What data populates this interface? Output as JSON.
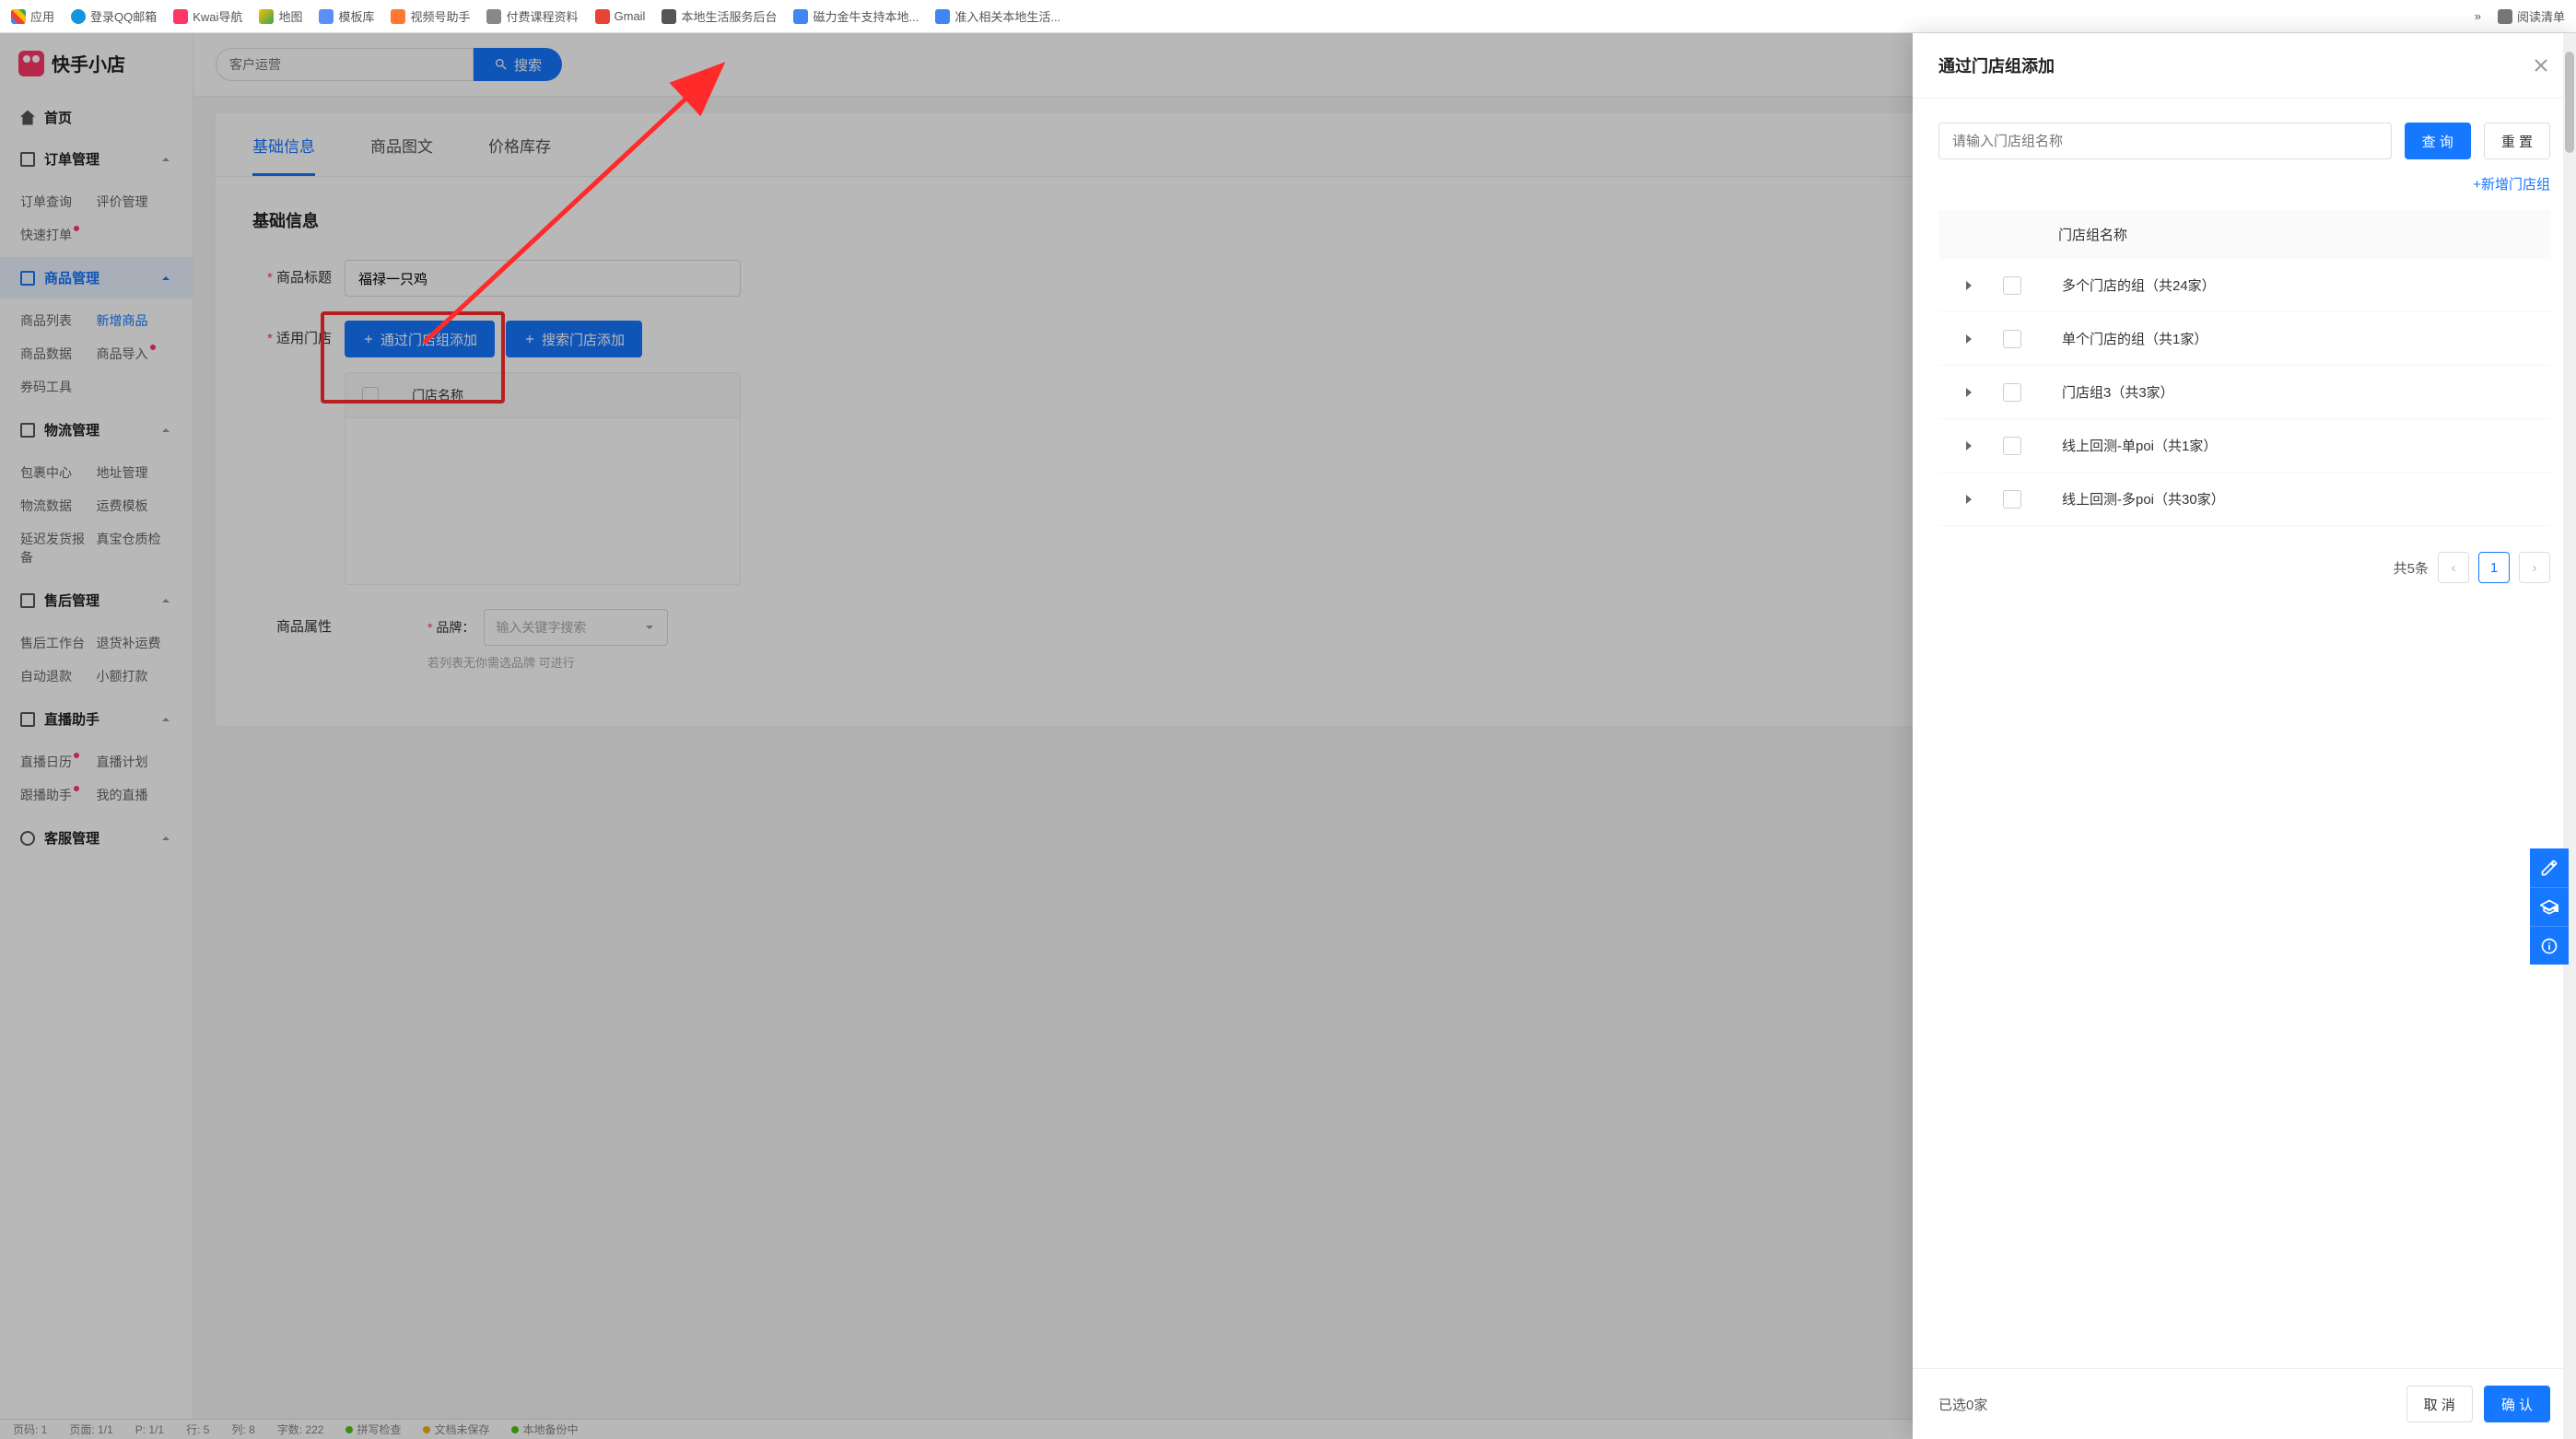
{
  "bookmarks": {
    "apps": "应用",
    "qq": "登录QQ邮箱",
    "kwai": "Kwai导航",
    "map": "地图",
    "template": "模板库",
    "video": "视频号助手",
    "paid": "付费课程资料",
    "gmail": "Gmail",
    "local_service": "本地生活服务后台",
    "magnet": "磁力金牛支持本地...",
    "ready": "准入相关本地生活...",
    "more": "»",
    "reading": "阅读清单"
  },
  "logo": "快手小店",
  "sidebar": {
    "home": "首页",
    "order_mgmt": "订单管理",
    "order_items": {
      "query": "订单查询",
      "review": "评价管理",
      "fast": "快速打单"
    },
    "product_mgmt": "商品管理",
    "product_items": {
      "list": "商品列表",
      "new": "新增商品",
      "data": "商品数据",
      "import": "商品导入",
      "coupon": "券码工具"
    },
    "logistics_mgmt": "物流管理",
    "logistics_items": {
      "parcel": "包裹中心",
      "addr": "地址管理",
      "data": "物流数据",
      "tpl": "运费模板",
      "delay": "延迟发货报备",
      "zhenbao": "真宝仓质检"
    },
    "after_mgmt": "售后管理",
    "after_items": {
      "workbench": "售后工作台",
      "refund_fee": "退货补运费",
      "auto_refund": "自动退款",
      "small_pay": "小额打款"
    },
    "live_mgmt": "直播助手",
    "live_items": {
      "cal": "直播日历",
      "plan": "直播计划",
      "follow": "跟播助手",
      "mine": "我的直播"
    },
    "cs_mgmt": "客服管理"
  },
  "top_search": {
    "placeholder": "客户运营",
    "button": "搜索"
  },
  "tabs": {
    "basic": "基础信息",
    "img": "商品图文",
    "price": "价格库存"
  },
  "form": {
    "section_title": "基础信息",
    "title_label": "商品标题",
    "title_value": "福禄一只鸡",
    "store_label": "适用门店",
    "btn_add_group": "通过门店组添加",
    "btn_add_search": "搜索门店添加",
    "table_header": "门店名称",
    "attr_label": "商品属性",
    "brand_label": "品牌：",
    "brand_placeholder": "输入关键字搜索",
    "brand_hint": "若列表无你需选品牌  可进行"
  },
  "drawer": {
    "title": "通过门店组添加",
    "search_placeholder": "请输入门店组名称",
    "query_btn": "查 询",
    "reset_btn": "重 置",
    "add_link": "+新增门店组",
    "col_name": "门店组名称",
    "rows": [
      "多个门店的组（共24家）",
      "单个门店的组（共1家）",
      "门店组3（共3家）",
      "线上回测-单poi（共1家）",
      "线上回测-多poi（共30家）"
    ],
    "total": "共5条",
    "page": "1",
    "selected": "已选0家",
    "cancel": "取 消",
    "confirm": "确 认"
  },
  "status_bar": {
    "pg1": "页码: 1",
    "pg2": "页面: 1/1",
    "p": "P: 1/1",
    "row": "行: 5",
    "col": "列: 8",
    "chars": "字数: 222",
    "check": "拼写检查",
    "save": "文档未保存",
    "local": "本地备份中"
  }
}
